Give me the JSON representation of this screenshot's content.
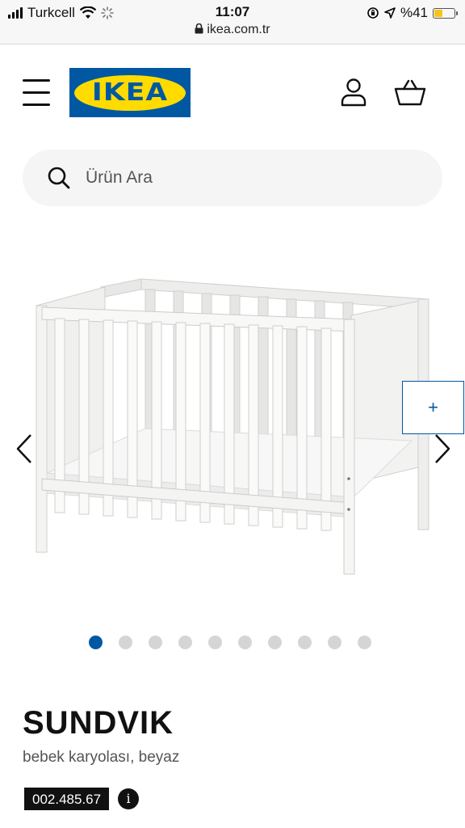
{
  "status_bar": {
    "carrier": "Turkcell",
    "time": "11:07",
    "url": "ikea.com.tr",
    "battery": "%41",
    "battery_level": 0.41,
    "icons": [
      "signal-icon",
      "wifi-icon",
      "loading-icon",
      "lock-icon",
      "orientation-lock-icon",
      "location-icon",
      "battery-icon"
    ]
  },
  "header": {
    "logo_text": "IKEA",
    "brand_colors": {
      "blue": "#0058a3",
      "yellow": "#ffdb00"
    },
    "icons": [
      "hamburger-menu-icon",
      "user-icon",
      "basket-icon"
    ]
  },
  "search": {
    "placeholder": "Ürün Ara",
    "icon": "search-icon"
  },
  "gallery": {
    "image_count": 10,
    "active_index": 0,
    "zoom_label": "+",
    "image": "white-baby-crib"
  },
  "product": {
    "name": "SUNDVIK",
    "description": "bebek karyolası, beyaz",
    "article_number": "002.485.67",
    "info_label": "i"
  }
}
